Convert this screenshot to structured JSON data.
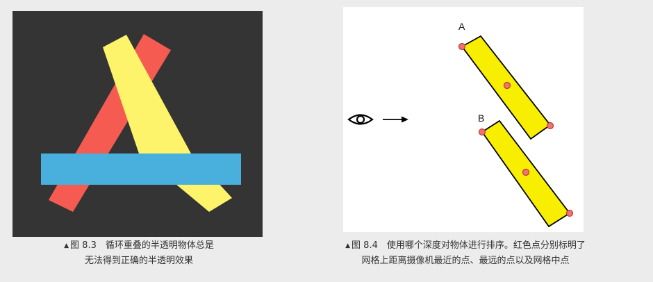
{
  "figure_left": {
    "colors": {
      "background": "#343434",
      "yellow_bar": "#fdf46b",
      "red_bar": "#f65b52",
      "blue_bar": "#49b0dd"
    },
    "caption": {
      "marker": "▲",
      "line1": "图 8.3　循环重叠的半透明物体总是",
      "line2": "无法得到正确的半透明效果"
    }
  },
  "figure_right": {
    "eye_icon": "eye-icon",
    "arrow_icon": "arrow-right-icon",
    "labels": {
      "a": "A",
      "b": "B"
    },
    "colors": {
      "block_fill": "#f7ee00",
      "block_stroke": "#000000",
      "point_fill": "#f47171",
      "point_stroke": "#b43c3c"
    },
    "caption": {
      "marker": "▲",
      "line1": "图 8.4　使用哪个深度对物体进行排序。红色点分别标明了",
      "line2": "网格上距离摄像机最近的点、最远的点以及网格中点"
    }
  }
}
